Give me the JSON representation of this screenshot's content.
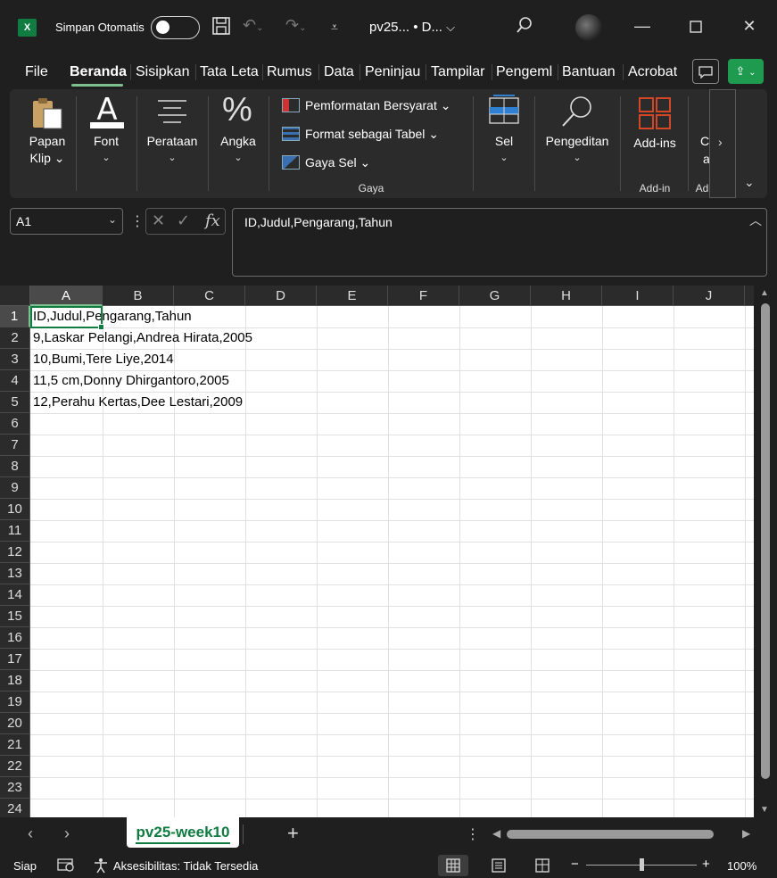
{
  "titlebar": {
    "app_icon": "X",
    "autosave_label": "Simpan Otomatis",
    "autosave_state": "off",
    "doc_title": "pv25...  • D...",
    "chevron": "⌵"
  },
  "tabs": [
    {
      "label": "File"
    },
    {
      "label": "Beranda"
    },
    {
      "label": "Sisipkan"
    },
    {
      "label": "Tata Leta"
    },
    {
      "label": "Rumus"
    },
    {
      "label": "Data"
    },
    {
      "label": "Peninjau"
    },
    {
      "label": "Tampilar"
    },
    {
      "label": "Pengeml"
    },
    {
      "label": "Bantuan"
    },
    {
      "label": "Acrobat"
    }
  ],
  "ribbon": {
    "papan_klip": [
      "Papan",
      "Klip ⌄"
    ],
    "font": "Font",
    "perataan": "Perataan",
    "angka": "Angka",
    "gaya_items": [
      "Pemformatan Bersyarat ⌄",
      "Format sebagai Tabel ⌄",
      "Gaya Sel ⌄"
    ],
    "gaya_caption": "Gaya",
    "sel": "Sel",
    "pengeditan": "Pengeditan",
    "addins": "Add-ins",
    "addins_caption": "Add-in",
    "trunc_label": "C",
    "trunc_label2": "a",
    "trunc_caption": "Ad"
  },
  "formula_bar": {
    "name_box": "A1",
    "fx": "fx",
    "content": "ID,Judul,Pengarang,Tahun"
  },
  "columns": [
    "A",
    "B",
    "C",
    "D",
    "E",
    "F",
    "G",
    "H",
    "I",
    "J"
  ],
  "rows": [
    "1",
    "2",
    "3",
    "4",
    "5",
    "6",
    "7",
    "8",
    "9",
    "10",
    "11",
    "12",
    "13",
    "14",
    "15",
    "16",
    "17",
    "18",
    "19",
    "20",
    "21",
    "22",
    "23",
    "24"
  ],
  "cells": [
    "ID,Judul,Pengarang,Tahun",
    "9,Laskar Pelangi,Andrea Hirata,2005",
    "10,Bumi,Tere Liye,2014",
    "11,5 cm,Donny Dhirgantoro,2005",
    "12,Perahu Kertas,Dee Lestari,2009"
  ],
  "sheet": {
    "name": "pv25-week10",
    "add": "+"
  },
  "status": {
    "ready": "Siap",
    "accessibility": "Aksesibilitas: Tidak Tersedia",
    "zoom": "100%",
    "zoom_minus": "−",
    "zoom_plus": "+"
  },
  "colors": {
    "accent_green": "#107c41",
    "tab_underline": "#7ec18f",
    "share_green": "#1e9b4f"
  }
}
